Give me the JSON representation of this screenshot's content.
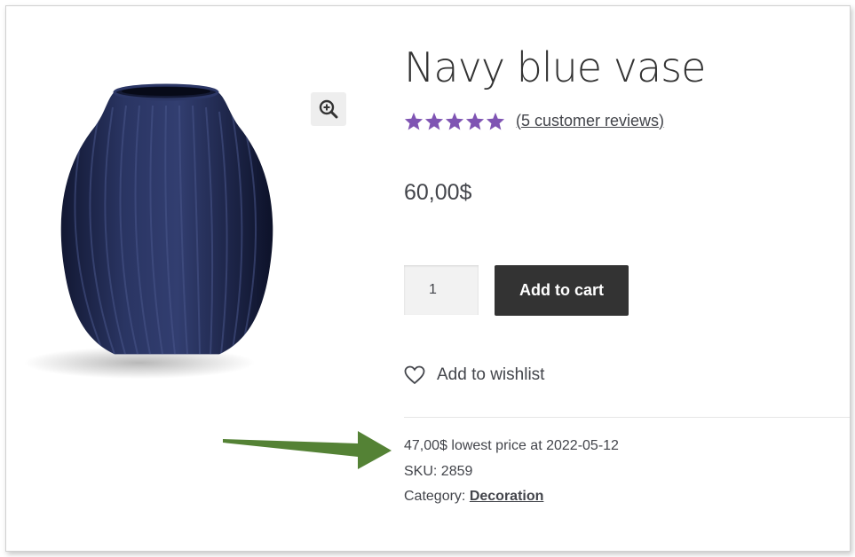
{
  "product": {
    "title": "Navy blue vase",
    "rating": {
      "value": 5,
      "max": 5,
      "reviews_link": "(5 customer reviews)"
    },
    "price": "60,00$",
    "quantity": "1",
    "add_to_cart_label": "Add to cart",
    "wishlist_label": "Add to wishlist",
    "lowest_price": "47,00$ lowest price at 2022-05-12",
    "sku_label": "SKU:",
    "sku_value": "2859",
    "category_label": "Category:",
    "category_value": "Decoration"
  },
  "colors": {
    "star": "#7f54b3",
    "button": "#333333",
    "arrow": "#548235",
    "vase": "#1f2747"
  },
  "icons": {
    "zoom": "zoom-in-icon",
    "wishlist": "heart-icon",
    "star": "star-icon"
  }
}
